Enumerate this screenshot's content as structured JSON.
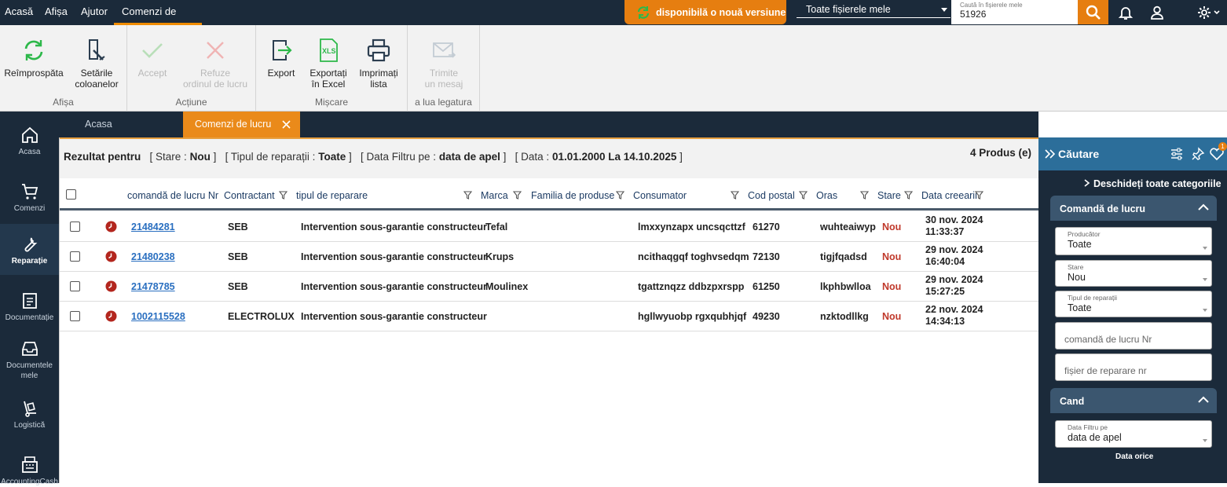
{
  "topbar": {
    "nav": [
      "Acasă",
      "Afișa",
      "Ajutor",
      "Comenzi de lucru"
    ],
    "update_label": "disponibilă o nouă versiune",
    "files_select": "Toate fișierele mele",
    "search_placeholder": "Caută în fișierele mele",
    "search_value": "51926"
  },
  "ribbon": {
    "groups": {
      "afisa": "Afișa",
      "actiune": "Acțiune",
      "miscare": "Mișcare",
      "legatura": "a lua legatura"
    },
    "buttons": {
      "refresh": "Reîmprospăta",
      "columns_1": "Setările",
      "columns_2": "coloanelor",
      "accept": "Accept",
      "refuse_1": "Refuze",
      "refuse_2": "ordinul de lucru",
      "export": "Export",
      "excel_1": "Exportați",
      "excel_2": "în Excel",
      "print_1": "Imprimați",
      "print_2": "lista",
      "msg_1": "Trimite",
      "msg_2": "un mesaj"
    }
  },
  "sidebar": [
    "Acasa",
    "Comenzi",
    "Reparație",
    "Documentație",
    "Documentele",
    "mele",
    "Logistică",
    "AccountingCash"
  ],
  "tabs": {
    "home": "Acasa",
    "active": "Comenzi de lucru"
  },
  "filter": {
    "prefix": "Rezultat pentru",
    "stare_l": "[ Stare :",
    "stare_v": "Nou",
    "stare_r": "]",
    "tip_l": "[ Tipul de reparații :",
    "tip_v": "Toate",
    "tip_r": "]",
    "df_l": "[ Data Filtru pe :",
    "df_v": "data de apel",
    "df_r": "]",
    "data_l": "[ Data :",
    "data_v": "01.01.2000 La 14.10.2025",
    "data_r": "]",
    "count": "4 Produs (e)"
  },
  "columns": [
    "comandă de lucru Nr",
    "Contractant",
    "tipul de reparare",
    "Marca",
    "Familia de produse",
    "Consumator",
    "Cod postal",
    "Oras",
    "Stare",
    "Data creearii"
  ],
  "rows": [
    {
      "nr": "21484281",
      "contractant": "SEB",
      "tip": "Intervention sous-garantie constructeur",
      "marca": "Tefal",
      "consumator": "lmxxynzapx uncsqcttzf",
      "cod": "61270",
      "oras": "wuhteaiwyp",
      "stare": "Nou",
      "d1": "30 nov. 2024",
      "d2": "11:33:37"
    },
    {
      "nr": "21480238",
      "contractant": "SEB",
      "tip": "Intervention sous-garantie constructeur",
      "marca": "Krups",
      "consumator": "ncithaqgqf toghvsedqm",
      "cod": "72130",
      "oras": "tigjfqadsd",
      "stare": "Nou",
      "d1": "29 nov. 2024",
      "d2": "16:40:04"
    },
    {
      "nr": "21478785",
      "contractant": "SEB",
      "tip": "Intervention sous-garantie constructeur",
      "marca": "Moulinex",
      "consumator": "tgattznqzz ddbzpxrspp",
      "cod": "61250",
      "oras": "lkphbwlloa",
      "stare": "Nou",
      "d1": "29 nov. 2024",
      "d2": "15:27:25"
    },
    {
      "nr": "1002115528",
      "contractant": "ELECTROLUX",
      "tip": "Intervention sous-garantie constructeur",
      "marca": "",
      "consumator": "hgllwyuobp rgxqubhjqf",
      "cod": "49230",
      "oras": "nzktodllkg",
      "stare": "Nou",
      "d1": "22 nov. 2024",
      "d2": "14:34:13"
    }
  ],
  "search_panel": {
    "title": "Căutare",
    "fav_badge": "1",
    "open_all": "Deschideți toate categoriile",
    "section1": "Comandă de lucru",
    "producator_l": "Producător",
    "producator_v": "Toate",
    "stare_l": "Stare",
    "stare_v": "Nou",
    "tip_l": "Tipul de reparații",
    "tip_v": "Toate",
    "nr_ph": "comandă de lucru Nr",
    "fisa_ph": "fișier de reparare nr",
    "section2": "Cand",
    "df_l": "Data Filtru pe",
    "df_v": "data de apel",
    "data_orice": "Data orice"
  },
  "colors": {
    "navy": "#1b2a3a",
    "orange": "#e67e10",
    "link": "#2a6fc0",
    "status_red": "#c0392b"
  }
}
